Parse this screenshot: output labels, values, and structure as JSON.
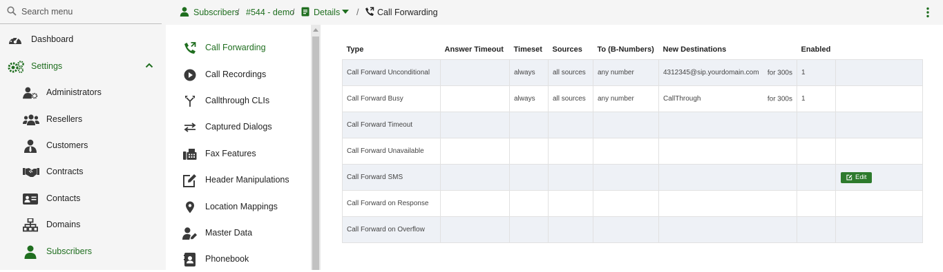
{
  "search": {
    "placeholder": "Search menu"
  },
  "sidebar": {
    "items": [
      {
        "label": "Dashboard",
        "icon": "dashboard-icon"
      },
      {
        "label": "Settings",
        "icon": "gears-icon"
      },
      {
        "label": "Administrators",
        "icon": "user-gear-icon"
      },
      {
        "label": "Resellers",
        "icon": "users-icon"
      },
      {
        "label": "Customers",
        "icon": "user-tie-icon"
      },
      {
        "label": "Contracts",
        "icon": "handshake-icon"
      },
      {
        "label": "Contacts",
        "icon": "address-card-icon"
      },
      {
        "label": "Domains",
        "icon": "sitemap-icon"
      },
      {
        "label": "Subscribers",
        "icon": "user-icon"
      }
    ]
  },
  "breadcrumb": {
    "subscribers": "Subscribers",
    "sep1": "/",
    "subscriber": "#544 - demo",
    "sep2": "/",
    "details": "Details",
    "sep3": "/",
    "current": "Call Forwarding"
  },
  "submenu": {
    "items": [
      {
        "label": "Call Forwarding",
        "icon": "phone-forward-icon"
      },
      {
        "label": "Call Recordings",
        "icon": "play-circle-icon"
      },
      {
        "label": "Callthrough CLIs",
        "icon": "fork-icon"
      },
      {
        "label": "Captured Dialogs",
        "icon": "swap-arrows-icon"
      },
      {
        "label": "Fax Features",
        "icon": "fax-icon"
      },
      {
        "label": "Header Manipulations",
        "icon": "edit-box-icon"
      },
      {
        "label": "Location Mappings",
        "icon": "map-marker-icon"
      },
      {
        "label": "Master Data",
        "icon": "user-edit-icon"
      },
      {
        "label": "Phonebook",
        "icon": "phonebook-icon"
      }
    ]
  },
  "table": {
    "headers": [
      "Type",
      "Answer Timeout",
      "Timeset",
      "Sources",
      "To (B-Numbers)",
      "New Destinations",
      "Enabled",
      ""
    ],
    "rows": [
      {
        "type": "Call Forward Unconditional",
        "answer_timeout": "",
        "timeset": "always",
        "sources": "all sources",
        "to": "any number",
        "destination": "4312345@sip.yourdomain.com",
        "dest_for": "for 300s",
        "enabled": "1"
      },
      {
        "type": "Call Forward Busy",
        "answer_timeout": "",
        "timeset": "always",
        "sources": "all sources",
        "to": "any number",
        "destination": "CallThrough",
        "dest_for": "for 300s",
        "enabled": "1"
      },
      {
        "type": "Call Forward Timeout",
        "answer_timeout": "",
        "timeset": "",
        "sources": "",
        "to": "",
        "destination": "",
        "dest_for": "",
        "enabled": ""
      },
      {
        "type": "Call Forward Unavailable",
        "answer_timeout": "",
        "timeset": "",
        "sources": "",
        "to": "",
        "destination": "",
        "dest_for": "",
        "enabled": ""
      },
      {
        "type": "Call Forward SMS",
        "answer_timeout": "",
        "timeset": "",
        "sources": "",
        "to": "",
        "destination": "",
        "dest_for": "",
        "enabled": "",
        "action": "Edit"
      },
      {
        "type": "Call Forward on Response",
        "answer_timeout": "",
        "timeset": "",
        "sources": "",
        "to": "",
        "destination": "",
        "dest_for": "",
        "enabled": ""
      },
      {
        "type": "Call Forward on Overflow",
        "answer_timeout": "",
        "timeset": "",
        "sources": "",
        "to": "",
        "destination": "",
        "dest_for": "",
        "enabled": ""
      }
    ]
  },
  "colors": {
    "accent": "#1f6e1f",
    "button": "#2d7a2d",
    "row_alt": "#eef1f6"
  }
}
